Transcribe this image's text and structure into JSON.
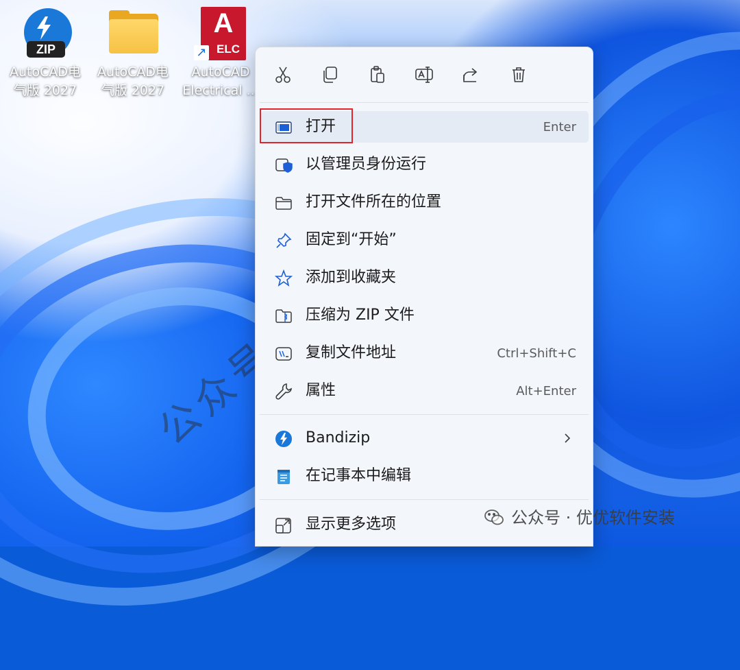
{
  "desktop": {
    "icons": [
      {
        "label": "AutoCAD电\n气版 2027",
        "badge": "ZIP"
      },
      {
        "label": "AutoCAD电\n气版 2027"
      },
      {
        "label": "AutoCAD\nElectrical ...",
        "tile_letter": "A",
        "tile_badge": "ELC"
      }
    ],
    "watermark": "公众号：优优软件安装",
    "wechat_footer": "公众号 · 优优软件安装"
  },
  "context_menu": {
    "toolbar": [
      {
        "icon": "cut-icon",
        "name": "cut"
      },
      {
        "icon": "copy-icon",
        "name": "copy"
      },
      {
        "icon": "paste-icon",
        "name": "paste"
      },
      {
        "icon": "rename-icon",
        "name": "rename"
      },
      {
        "icon": "share-icon",
        "name": "share"
      },
      {
        "icon": "delete-icon",
        "name": "delete"
      }
    ],
    "items": [
      {
        "label": "打开",
        "shortcut": "Enter",
        "icon": "open-window-icon",
        "highlighted": true
      },
      {
        "label": "以管理员身份运行",
        "shortcut": "",
        "icon": "shield-icon"
      },
      {
        "label": "打开文件所在的位置",
        "shortcut": "",
        "icon": "folder-icon"
      },
      {
        "label": "固定到“开始”",
        "shortcut": "",
        "icon": "pin-icon"
      },
      {
        "label": "添加到收藏夹",
        "shortcut": "",
        "icon": "star-icon"
      },
      {
        "label": "压缩为 ZIP 文件",
        "shortcut": "",
        "icon": "zip-folder-icon"
      },
      {
        "label": "复制文件地址",
        "shortcut": "Ctrl+Shift+C",
        "icon": "copy-path-icon"
      },
      {
        "label": "属性",
        "shortcut": "Alt+Enter",
        "icon": "wrench-icon"
      },
      {
        "label": "Bandizip",
        "shortcut": "",
        "icon": "bandizip-icon",
        "submenu": true
      },
      {
        "label": "在记事本中编辑",
        "shortcut": "",
        "icon": "notepad-icon"
      },
      {
        "label": "显示更多选项",
        "shortcut": "",
        "icon": "more-options-icon"
      }
    ]
  },
  "colors": {
    "menu_bg": "#f3f6fb",
    "highlight_box": "#e3242b",
    "autocad_red": "#c7182e",
    "bandizip_blue": "#1a78d9"
  }
}
